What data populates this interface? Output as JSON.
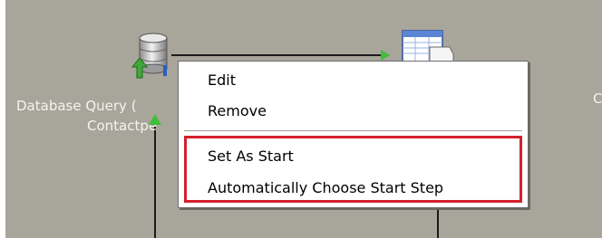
{
  "canvas": {
    "background": "#a8a59b",
    "nodes": [
      {
        "icon": "database-query-icon",
        "label_line1": "Database Query (",
        "label_line2": "Contactpe"
      },
      {
        "icon": "table-output-icon"
      },
      {
        "label_partial": "C"
      }
    ]
  },
  "context_menu": {
    "items": [
      {
        "label": "Edit"
      },
      {
        "label": "Remove"
      },
      {
        "label": "Set As Start"
      },
      {
        "label": "Automatically Choose Start Step"
      }
    ],
    "highlight_color": "#d4202c"
  }
}
